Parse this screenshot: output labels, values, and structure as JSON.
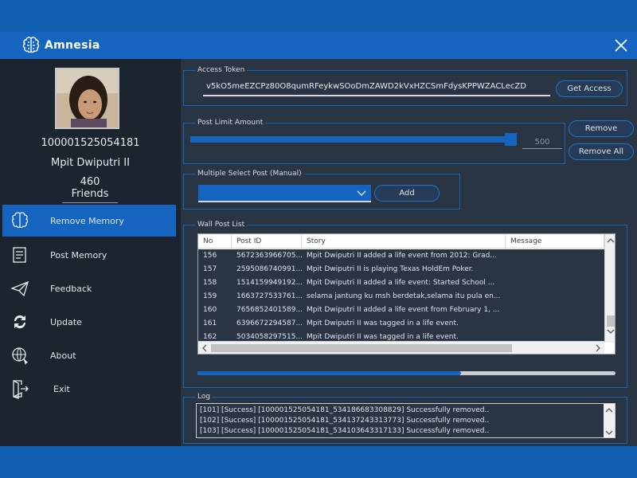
{
  "app": {
    "title": "Amnesia"
  },
  "profile": {
    "id": "100001525054181",
    "name": "Mpit Dwiputri II",
    "friends": "460 Friends"
  },
  "nav": [
    {
      "label": "Remove Memory",
      "icon": "brain-icon",
      "active": true
    },
    {
      "label": "Post Memory",
      "icon": "document-icon",
      "active": false
    },
    {
      "label": "Feedback",
      "icon": "paper-plane-icon",
      "active": false
    },
    {
      "label": "Update",
      "icon": "refresh-icon",
      "active": false
    },
    {
      "label": "About",
      "icon": "globe-cursor-icon",
      "active": false
    },
    {
      "label": "Exit",
      "icon": "exit-door-icon",
      "active": false
    }
  ],
  "access_token": {
    "group_label": "Access Token",
    "value": "v5kO5meEZCPz80O8qumRFeykwSOoDmZAWD2kVxHZCSmFdysKPPWZACLecZD",
    "button": "Get Access"
  },
  "post_limit": {
    "group_label": "Post Limit Amount",
    "value": "500",
    "fill_fraction": 0.98,
    "remove_button": "Remove",
    "remove_all_button": "Remove All"
  },
  "multi_select": {
    "group_label": "Multiple Select Post (Manual)",
    "selected": "",
    "add_button": "Add"
  },
  "wall_posts": {
    "group_label": "Wall Post List",
    "columns": [
      "No",
      "Post ID",
      "Story",
      "Message"
    ],
    "rows": [
      {
        "no": "156",
        "post_id": "5672363966705...",
        "story": "Mpit Dwiputri II added a life event from 2012: Grad...",
        "message": ""
      },
      {
        "no": "157",
        "post_id": "2595086740991...",
        "story": "Mpit Dwiputri II is playing Texas HoldEm Poker.",
        "message": ""
      },
      {
        "no": "158",
        "post_id": "1514159949192...",
        "story": "Mpit Dwiputri II added a life event: Started School ...",
        "message": ""
      },
      {
        "no": "159",
        "post_id": "1663727533761...",
        "story": "selama jantung ku msh berdetak,selama itu pula en...",
        "message": ""
      },
      {
        "no": "160",
        "post_id": "7656852401589...",
        "story": "Mpit Dwiputri II added a life event from February 1, ...",
        "message": ""
      },
      {
        "no": "161",
        "post_id": "6396672294587...",
        "story": "Mpit Dwiputri II was tagged in a life event.",
        "message": ""
      },
      {
        "no": "162",
        "post_id": "5034058297515...",
        "story": "Mpit Dwiputri II was tagged in a life event.",
        "message": ""
      }
    ],
    "progress_fraction": 0.63
  },
  "log": {
    "group_label": "Log",
    "lines": [
      "[101] [Success] [100001525054181_534186683308829] Successfully removed..",
      "[102] [Success] [100001525054181_534137243313773] Successfully removed..",
      "[103] [Success] [100001525054181_534103643317133] Successfully removed.."
    ]
  },
  "colors": {
    "accent": "#1565c0",
    "panel": "#2a3544",
    "sidebar": "#1c2430",
    "desktop": "#0e5fb0"
  }
}
